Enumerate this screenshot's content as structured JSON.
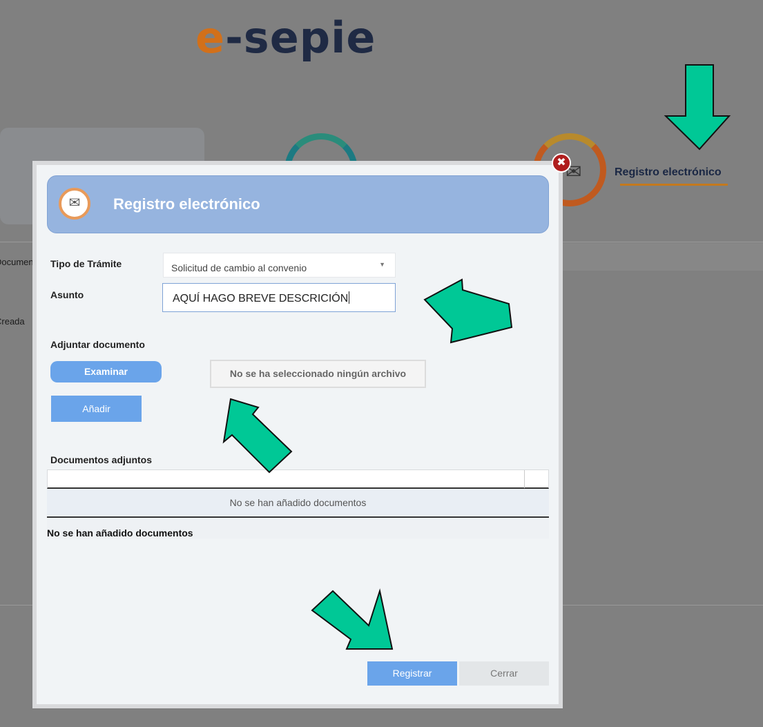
{
  "logo": {
    "accent": "e",
    "rest": "-sepie"
  },
  "background": {
    "side_text_1": "Documentos",
    "side_text_2": "Creada",
    "registro_title": "Registro electrónico",
    "close_symbol": "✖",
    "card_icon": "certificate-icon"
  },
  "modal": {
    "title": "Registro electrónico",
    "icon": "envelope-certificate-icon",
    "tipo_label": "Tipo de Trámite",
    "tipo_value": "Solicitud de cambio al convenio",
    "asunto_label": "Asunto",
    "asunto_value": "AQUÍ HAGO BREVE DESCRICIÓN",
    "adjuntar_label": "Adjuntar documento",
    "examinar_label": "Examinar",
    "file_status": "No se ha seleccionado ningún archivo",
    "anadir_label": "Añadir",
    "docs_label": "Documentos adjuntos",
    "table_empty": "No se han añadido documentos",
    "table_footer": "No se han añadido documentos",
    "registrar_label": "Registrar",
    "cerrar_label": "Cerrar"
  },
  "colors": {
    "header_bg": "#96b4df",
    "button_blue": "#6aa4ea",
    "arrow_green": "#00c896",
    "accent_orange": "#d2701a"
  }
}
